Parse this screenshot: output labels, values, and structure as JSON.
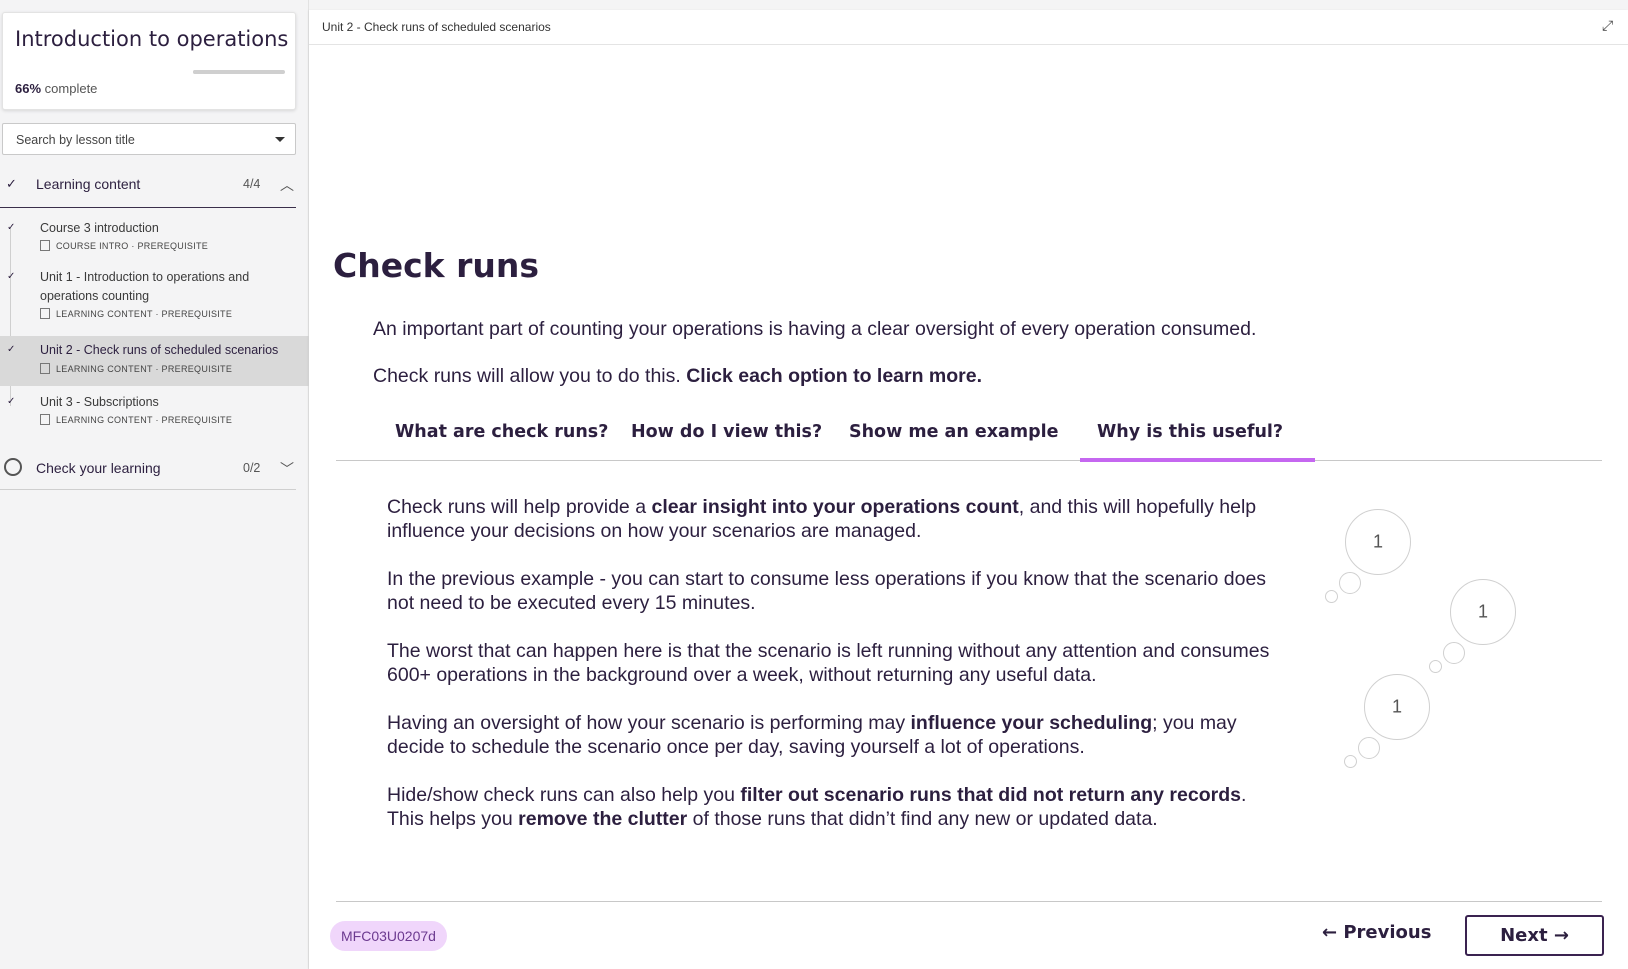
{
  "sidebar": {
    "course_title": "Introduction to operations",
    "progress_percent_value": 66,
    "progress_percent": "66%",
    "progress_suffix": "complete",
    "search_placeholder": "Search by lesson title",
    "sections": [
      {
        "label": "Learning content",
        "count": "4/4",
        "expanded": true,
        "lessons": [
          {
            "title": "Course 3 introduction",
            "meta": "COURSE INTRO · PREREQUISITE"
          },
          {
            "title": "Unit 1 - Introduction to operations and operations counting",
            "meta": "LEARNING CONTENT · PREREQUISITE"
          },
          {
            "title": "Unit 2 - Check runs of scheduled scenarios",
            "meta": "LEARNING CONTENT · PREREQUISITE"
          },
          {
            "title": "Unit 3 - Subscriptions",
            "meta": "LEARNING CONTENT · PREREQUISITE"
          }
        ]
      },
      {
        "label": "Check your learning",
        "count": "0/2",
        "expanded": false
      }
    ]
  },
  "main": {
    "breadcrumb": "Unit 2 - Check runs of scheduled scenarios",
    "heading": "Check runs",
    "intro_line1": "An important part of counting your operations is having a clear oversight of every operation consumed.",
    "intro_line2_plain": "Check runs will allow you to do this. ",
    "intro_line2_bold": "Click each option to learn more.",
    "tabs": [
      {
        "label": "What are check runs?"
      },
      {
        "label": "How do I view this?"
      },
      {
        "label": "Show me an example"
      },
      {
        "label": "Why is this useful?",
        "active": true
      }
    ],
    "paragraphs": {
      "p1_a": "Check runs will help provide a ",
      "p1_b": "clear insight into your operations count",
      "p1_c": ", and this will hopefully help influence your decisions on how your scenarios are managed.",
      "p2": "In the previous example - you can start to consume less operations if you know that the scenario does not need to be executed every 15 minutes.",
      "p3": "The worst that can happen here is that the scenario is left running without any attention and consumes 600+ operations in the background over a week, without returning any useful data.",
      "p4_a": "Having an oversight of how your scenario is performing may ",
      "p4_b": "influence your scheduling",
      "p4_c": "; you may decide to schedule the scenario once per day, saving yourself a lot of operations.",
      "p5_a": "Hide/show check runs can also help you ",
      "p5_b": "filter out scenario runs that did not return any records",
      "p5_c": ". This helps you ",
      "p5_d": "remove the clutter",
      "p5_e": " of those runs that didn’t find any new or updated data."
    },
    "bubbles": [
      "1",
      "1",
      "1"
    ],
    "footer": {
      "code": "MFC03U0207d",
      "previous_label": "← Previous",
      "next_label": "Next →"
    }
  },
  "colors": {
    "accent": "#c567f0",
    "text": "#2c1f3f",
    "badge_bg": "#f0d6fb"
  }
}
